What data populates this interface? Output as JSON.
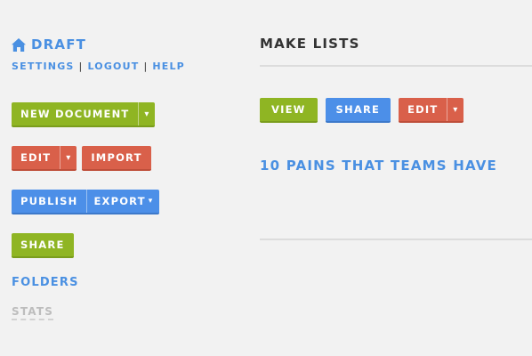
{
  "sidebar": {
    "brand_icon": "home-icon",
    "brand": "DRAFT",
    "links": [
      "SETTINGS",
      "LOGOUT",
      "HELP"
    ],
    "link_separator": "|",
    "new_document": "NEW DOCUMENT",
    "edit": "EDIT",
    "import": "IMPORT",
    "publish": "PUBLISH",
    "export": "EXPORT",
    "share": "SHARE",
    "folders": "FOLDERS",
    "stats": "STATS",
    "caret": "▾"
  },
  "main": {
    "title": "MAKE LISTS",
    "view": "VIEW",
    "share": "SHARE",
    "edit": "EDIT",
    "caret": "▾",
    "document_title": "10 PAINS THAT TEAMS HAVE"
  },
  "colors": {
    "accent_blue": "#4a90e2",
    "green": "#8fb523",
    "red": "#d9604a",
    "blue": "#4c8fe8",
    "background": "#f2f2f2"
  }
}
